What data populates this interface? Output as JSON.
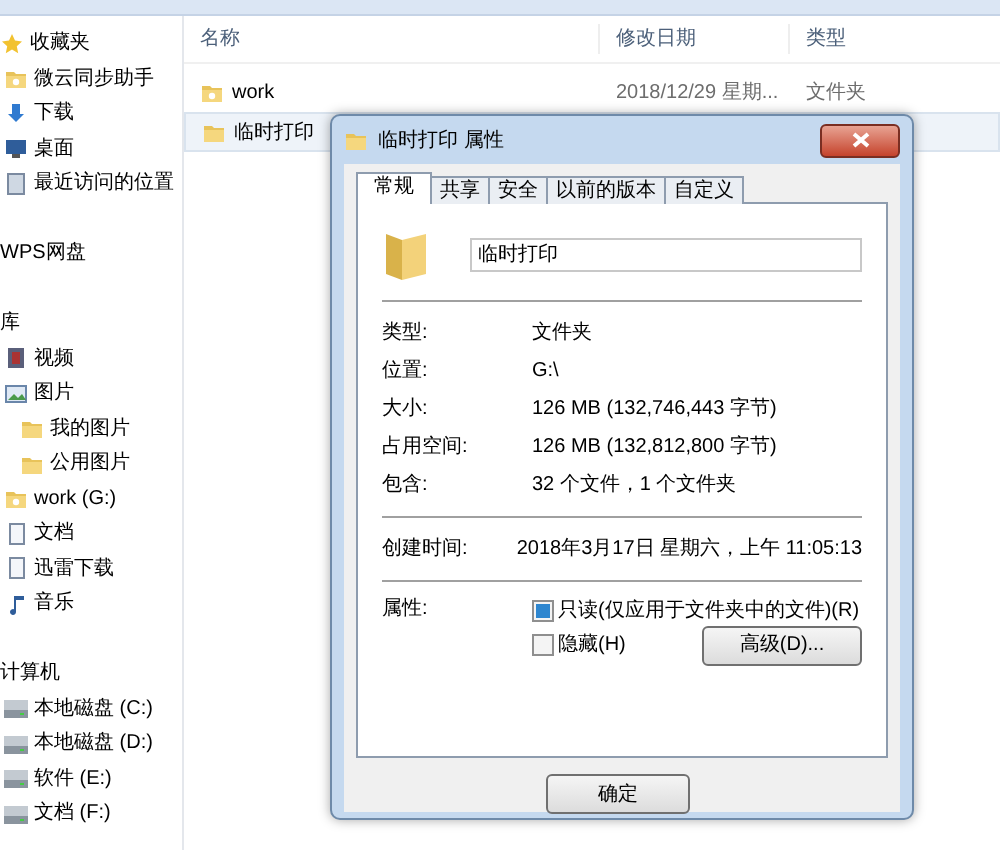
{
  "sidebar": {
    "items": [
      {
        "label": "收藏夹",
        "kind": "star",
        "children": [
          {
            "label": "微云同步助手",
            "kind": "cloud-folder"
          },
          {
            "label": "下载",
            "kind": "download"
          },
          {
            "label": "桌面",
            "kind": "desktop"
          },
          {
            "label": "最近访问的位置",
            "kind": "recent"
          }
        ]
      },
      {
        "label": "WPS网盘",
        "kind": "plain"
      },
      {
        "label": "库",
        "kind": "plain",
        "children": [
          {
            "label": "视频",
            "kind": "video"
          },
          {
            "label": "图片",
            "kind": "image",
            "children": [
              {
                "label": "我的图片",
                "kind": "folder"
              },
              {
                "label": "公用图片",
                "kind": "folder"
              }
            ]
          },
          {
            "label": "work (G:)",
            "kind": "cloud-folder"
          },
          {
            "label": "文档",
            "kind": "doc"
          },
          {
            "label": "迅雷下载",
            "kind": "doc"
          },
          {
            "label": "音乐",
            "kind": "music"
          }
        ]
      },
      {
        "label": "计算机",
        "kind": "plain",
        "children": [
          {
            "label": "本地磁盘 (C:)",
            "kind": "drive"
          },
          {
            "label": "本地磁盘 (D:)",
            "kind": "drive"
          },
          {
            "label": "软件 (E:)",
            "kind": "drive"
          },
          {
            "label": "文档 (F:)",
            "kind": "drive"
          }
        ]
      }
    ]
  },
  "file_list": {
    "columns": [
      "名称",
      "修改日期",
      "类型"
    ],
    "rows": [
      {
        "name": "work",
        "kind": "cloud-folder",
        "modified": "2018/12/29 星期...",
        "type": "文件夹",
        "selected": false
      },
      {
        "name": "临时打印",
        "kind": "folder",
        "selected": true
      }
    ]
  },
  "dialog": {
    "title": "临时打印 属性",
    "tabs": [
      {
        "label": "常规",
        "selected": true
      },
      {
        "label": "共享",
        "selected": false
      },
      {
        "label": "安全",
        "selected": false
      },
      {
        "label": "以前的版本",
        "selected": false
      },
      {
        "label": "自定义",
        "selected": false
      }
    ],
    "name_value": "临时打印",
    "groups": [
      [
        {
          "label": "类型:",
          "value": "文件夹"
        },
        {
          "label": "位置:",
          "value": "G:\\"
        },
        {
          "label": "大小:",
          "value": "126 MB (132,746,443 字节)"
        },
        {
          "label": "占用空间:",
          "value": "126 MB (132,812,800 字节)"
        },
        {
          "label": "包含:",
          "value": "32 个文件，1 个文件夹"
        }
      ],
      [
        {
          "label": "创建时间:",
          "value": "2018年3月17日 星期六，上午 11:05:13"
        }
      ]
    ],
    "attributes_label": "属性:",
    "attributes": [
      {
        "label": "只读(仅应用于文件夹中的文件)(R)",
        "checked": true
      },
      {
        "label": "隐藏(H)",
        "checked": false
      }
    ],
    "advanced_button": "高级(D)...",
    "buttons": [
      "确定"
    ]
  }
}
